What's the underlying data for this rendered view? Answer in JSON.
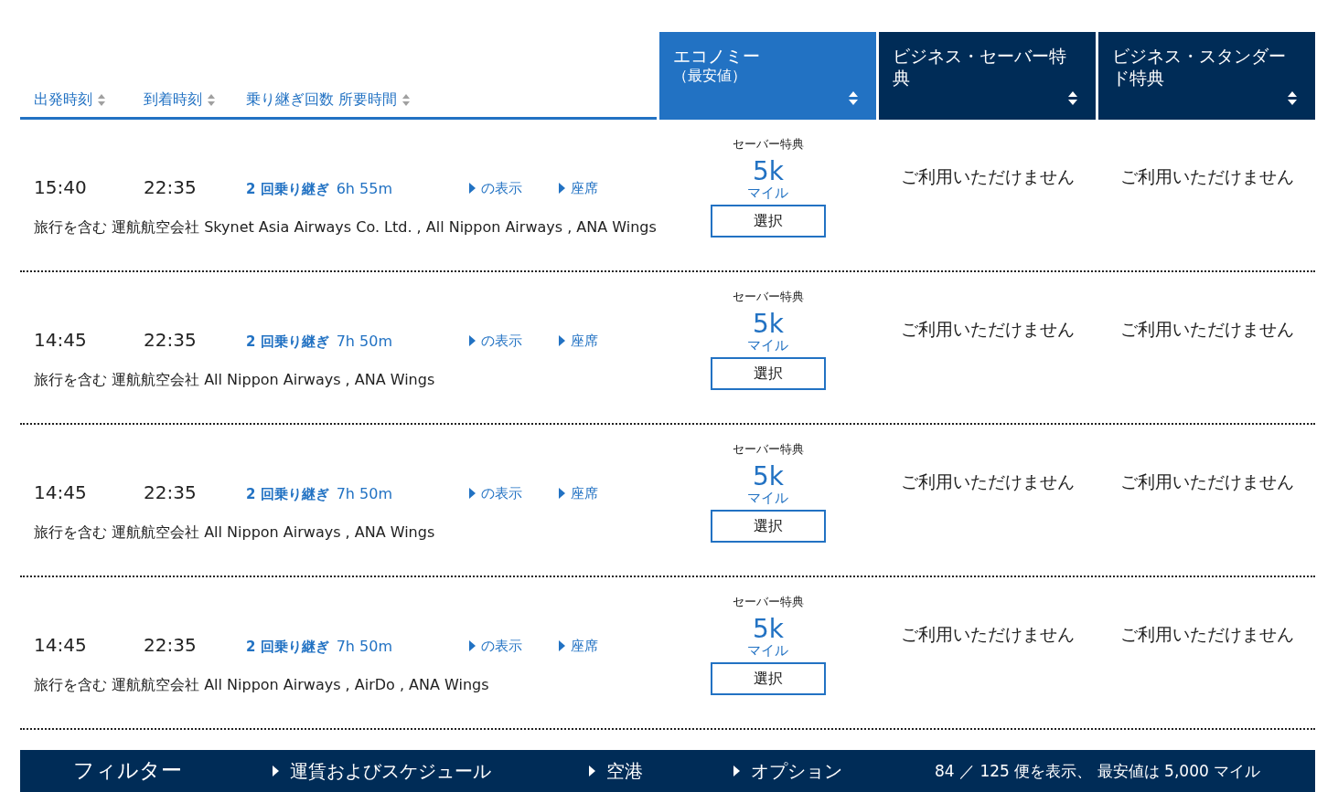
{
  "sort_headers": [
    {
      "label": "出発時刻"
    },
    {
      "label": "到着時刻"
    },
    {
      "label": "乗り継ぎ回数 所要時間"
    }
  ],
  "fare_columns": [
    {
      "label": "エコノミー",
      "sublabel": "（最安値）",
      "selected": true
    },
    {
      "label": "ビジネス・セーバー特典",
      "selected": false
    },
    {
      "label": "ビジネス・スタンダード特典",
      "selected": false
    }
  ],
  "flights": [
    {
      "depart": "15:40",
      "arrive": "22:35",
      "stops": "2 回乗り継ぎ",
      "duration": "6h 55m",
      "details_link": "の表示",
      "seats_link": "座席",
      "operators": "旅行を含む 運航航空会社 Skynet Asia Airways Co. Ltd. , All Nippon Airways , ANA Wings",
      "fares": [
        {
          "kind": "offer",
          "label": "セーバー特典",
          "amount": "5k",
          "unit": "マイル",
          "button": "選択"
        },
        {
          "kind": "unavailable",
          "text": "ご利用いただけません"
        },
        {
          "kind": "unavailable",
          "text": "ご利用いただけません"
        }
      ]
    },
    {
      "depart": "14:45",
      "arrive": "22:35",
      "stops": "2 回乗り継ぎ",
      "duration": "7h 50m",
      "details_link": "の表示",
      "seats_link": "座席",
      "operators": "旅行を含む 運航航空会社 All Nippon Airways , ANA Wings",
      "fares": [
        {
          "kind": "offer",
          "label": "セーバー特典",
          "amount": "5k",
          "unit": "マイル",
          "button": "選択"
        },
        {
          "kind": "unavailable",
          "text": "ご利用いただけません"
        },
        {
          "kind": "unavailable",
          "text": "ご利用いただけません"
        }
      ]
    },
    {
      "depart": "14:45",
      "arrive": "22:35",
      "stops": "2 回乗り継ぎ",
      "duration": "7h 50m",
      "details_link": "の表示",
      "seats_link": "座席",
      "operators": "旅行を含む 運航航空会社 All Nippon Airways , ANA Wings",
      "fares": [
        {
          "kind": "offer",
          "label": "セーバー特典",
          "amount": "5k",
          "unit": "マイル",
          "button": "選択"
        },
        {
          "kind": "unavailable",
          "text": "ご利用いただけません"
        },
        {
          "kind": "unavailable",
          "text": "ご利用いただけません"
        }
      ]
    },
    {
      "depart": "14:45",
      "arrive": "22:35",
      "stops": "2 回乗り継ぎ",
      "duration": "7h 50m",
      "details_link": "の表示",
      "seats_link": "座席",
      "operators": "旅行を含む 運航航空会社 All Nippon Airways , AirDo , ANA Wings",
      "fares": [
        {
          "kind": "offer",
          "label": "セーバー特典",
          "amount": "5k",
          "unit": "マイル",
          "button": "選択"
        },
        {
          "kind": "unavailable",
          "text": "ご利用いただけません"
        },
        {
          "kind": "unavailable",
          "text": "ご利用いただけません"
        }
      ]
    }
  ],
  "filter_bar": {
    "title": "フィルター",
    "sections": [
      {
        "label": "運賃およびスケジュール",
        "expanded": false
      },
      {
        "label": "空港",
        "expanded": false
      },
      {
        "label": "オプション",
        "expanded": false
      }
    ],
    "summary": "84 ／ 125 便を表示、 最安値は 5,000 マイル"
  }
}
